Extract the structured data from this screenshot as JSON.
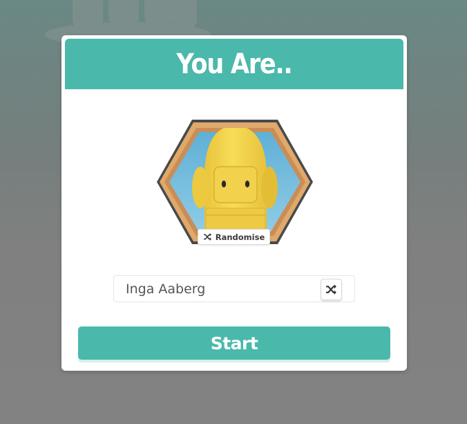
{
  "modal": {
    "title": "You Are..",
    "randomise_label": "Randomise",
    "name_value": "Inga Aaberg",
    "start_label": "Start"
  },
  "icons": {
    "avatar": "yellow-character-avatar-icon",
    "randomise": "shuffle-icon",
    "name_shuffle": "shuffle-icon"
  },
  "colors": {
    "accent": "#4ab9ab",
    "background": "#7f8483",
    "avatar_frame": "#e1a96e",
    "avatar_body": "#f4d54c"
  }
}
